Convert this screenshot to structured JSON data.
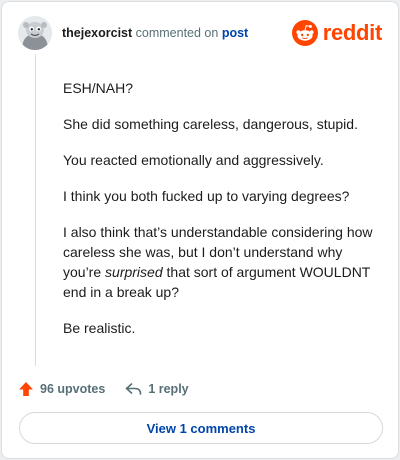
{
  "header": {
    "username": "thejexorcist",
    "action_text": "commented on",
    "post_link": "post",
    "logo_text": "reddit"
  },
  "comment": {
    "paragraphs": [
      {
        "text": "ESH/NAH?"
      },
      {
        "text": "She did something careless, dangerous, stupid."
      },
      {
        "text": "You reacted emotionally and aggressively."
      },
      {
        "text": "I think you both fucked up to varying degrees?"
      },
      {
        "pre": "I also think that’s understandable considering how careless she was, but I don’t understand why you’re ",
        "em": "surprised",
        "post": " that sort of argument WOULDNT end in a break up?"
      },
      {
        "text": "Be realistic."
      }
    ]
  },
  "actions": {
    "upvotes_label": "96 upvotes",
    "reply_label": "1 reply"
  },
  "view_comments_label": "View 1 comments",
  "colors": {
    "brand": "#ff4500",
    "link": "#0045ac",
    "muted": "#576f76",
    "upvote": "#ff4500"
  }
}
